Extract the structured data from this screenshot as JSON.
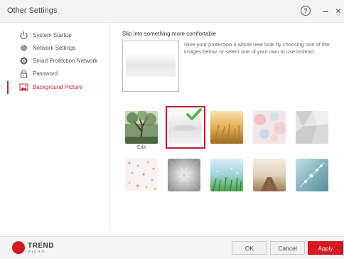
{
  "window": {
    "title": "Other Settings",
    "help_symbol": "?",
    "minimize_symbol": "–",
    "close_symbol": "×"
  },
  "sidebar": {
    "items": [
      {
        "label": "System Startup",
        "icon": "power-icon",
        "active": false
      },
      {
        "label": "Network Settings",
        "icon": "gear-icon",
        "active": false
      },
      {
        "label": "Smart Protection Network",
        "icon": "globe-icon",
        "active": false
      },
      {
        "label": "Password",
        "icon": "lock-icon",
        "active": false
      },
      {
        "label": "Background Picture",
        "icon": "picture-icon",
        "active": true
      }
    ]
  },
  "main": {
    "heading": "Slip into something more comfortable",
    "description": "Give your protection a whole new look by choosing one of the images below, or select one of your own to use instead.",
    "edit_label": "Edit",
    "thumbnails": [
      {
        "name": "forest-tree",
        "row": 1,
        "col": 1
      },
      {
        "name": "plain-gray",
        "row": 1,
        "col": 2,
        "selected": true
      },
      {
        "name": "golden-wheat",
        "row": 1,
        "col": 3
      },
      {
        "name": "pastel-bokeh",
        "row": 1,
        "col": 4
      },
      {
        "name": "gray-geometric",
        "row": 1,
        "col": 5
      },
      {
        "name": "confetti-dots",
        "row": 2,
        "col": 1
      },
      {
        "name": "silver-radial",
        "row": 2,
        "col": 2
      },
      {
        "name": "green-meadow",
        "row": 2,
        "col": 3
      },
      {
        "name": "wooden-dock",
        "row": 2,
        "col": 4
      },
      {
        "name": "teal-blossoms",
        "row": 2,
        "col": 5
      }
    ],
    "accent_color": "#c8202f"
  },
  "footer": {
    "logo_name": "TREND",
    "logo_subtext": "MICRO",
    "ok_label": "OK",
    "cancel_label": "Cancel",
    "apply_label": "Apply"
  }
}
